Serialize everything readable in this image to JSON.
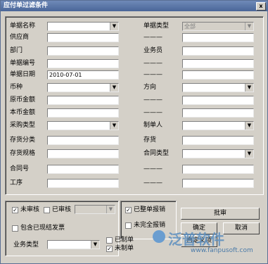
{
  "window": {
    "title": "应付单过滤条件",
    "close_glyph": "x"
  },
  "fields_left": [
    {
      "label": "单据名称",
      "type": "combo",
      "value": ""
    },
    {
      "label": "供应商",
      "type": "text",
      "value": ""
    },
    {
      "label": "部门",
      "type": "text",
      "value": ""
    },
    {
      "label": "单据编号",
      "type": "text",
      "value": ""
    },
    {
      "label": "单据日期",
      "type": "text",
      "value": "2010-07-01"
    },
    {
      "label": "币种",
      "type": "combo",
      "value": ""
    },
    {
      "label": "原币金额",
      "type": "text",
      "value": ""
    },
    {
      "label": "本币金额",
      "type": "text",
      "value": ""
    },
    {
      "label": "采购类型",
      "type": "combo",
      "value": ""
    },
    {
      "label": "存货分类",
      "type": "text",
      "value": ""
    },
    {
      "label": "存货规格",
      "type": "text",
      "value": ""
    },
    {
      "label": "合同号",
      "type": "text",
      "value": ""
    },
    {
      "label": "工序",
      "type": "text",
      "value": ""
    }
  ],
  "fields_right": [
    {
      "label": "单据类型",
      "type": "combo",
      "value": "全部",
      "disabled": true
    },
    {
      "label": "———",
      "type": "text",
      "value": ""
    },
    {
      "label": "业务员",
      "type": "text",
      "value": ""
    },
    {
      "label": "———",
      "type": "text",
      "value": ""
    },
    {
      "label": "———",
      "type": "text",
      "value": ""
    },
    {
      "label": "方向",
      "type": "combo",
      "value": ""
    },
    {
      "label": "———",
      "type": "text",
      "value": ""
    },
    {
      "label": "———",
      "type": "text",
      "value": ""
    },
    {
      "label": "制单人",
      "type": "combo",
      "value": ""
    },
    {
      "label": "存货",
      "type": "text",
      "value": ""
    },
    {
      "label": "合同类型",
      "type": "combo",
      "value": ""
    },
    {
      "label": "———",
      "type": "text",
      "value": ""
    },
    {
      "label": "———",
      "type": "text",
      "value": ""
    }
  ],
  "bottom": {
    "unaudited": {
      "label": "未审核",
      "checked": true
    },
    "audited": {
      "label": "已审核",
      "checked": false
    },
    "include_settled": {
      "label": "包含已现结发票",
      "checked": false
    },
    "biz_type_label": "业务类型",
    "made": {
      "label": "已制单",
      "checked": false
    },
    "not_made": {
      "label": "未制单",
      "checked": true
    },
    "whole_reimbursed": {
      "label": "已整单报销",
      "checked": true
    },
    "not_fully_reimbursed": {
      "label": "未完全报销",
      "checked": false
    },
    "batch_button": "批审",
    "ok_button": "确定",
    "cancel_button": "取消",
    "custom_button": "自定义项"
  },
  "watermark": {
    "text": "泛普软件",
    "url": "www.fanpusoft.com"
  },
  "checkmark": "✓",
  "dropdown_glyph": "▼"
}
